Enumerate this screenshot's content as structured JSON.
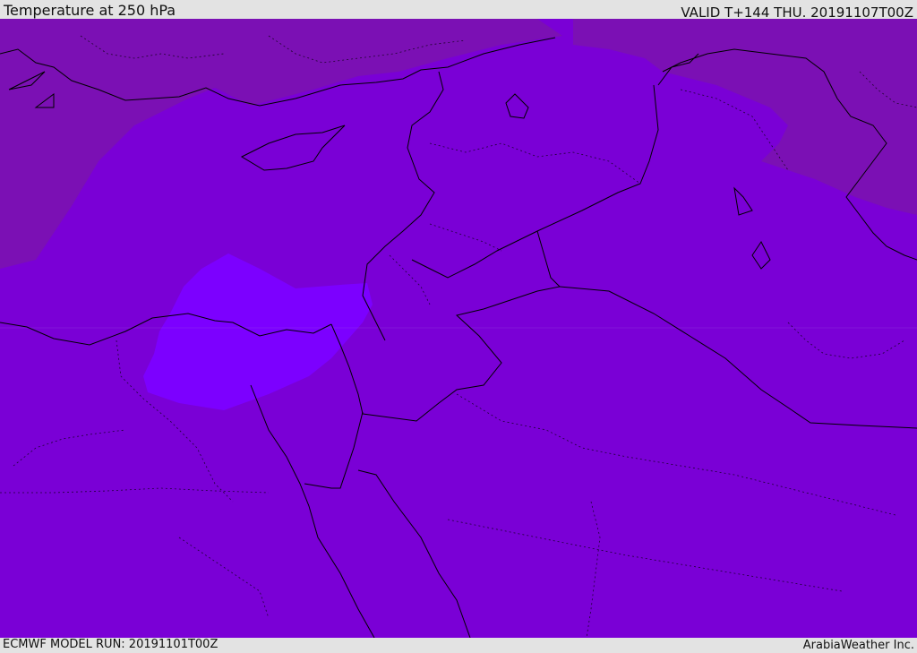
{
  "header": {
    "title": "Temperature at 250 hPa",
    "valid": "VALID T+144 THU. 20191107T00Z"
  },
  "footer": {
    "model_run": "ECMWF MODEL RUN: 20191101T00Z",
    "credit": "ArabiaWeather Inc."
  },
  "colors": {
    "background_band": "#7a00d6",
    "cold_band_north": "#7b10b4",
    "warm_pocket": "#7c00ff",
    "boundary_line": "#000000",
    "chrome": "#e3e3e3"
  }
}
